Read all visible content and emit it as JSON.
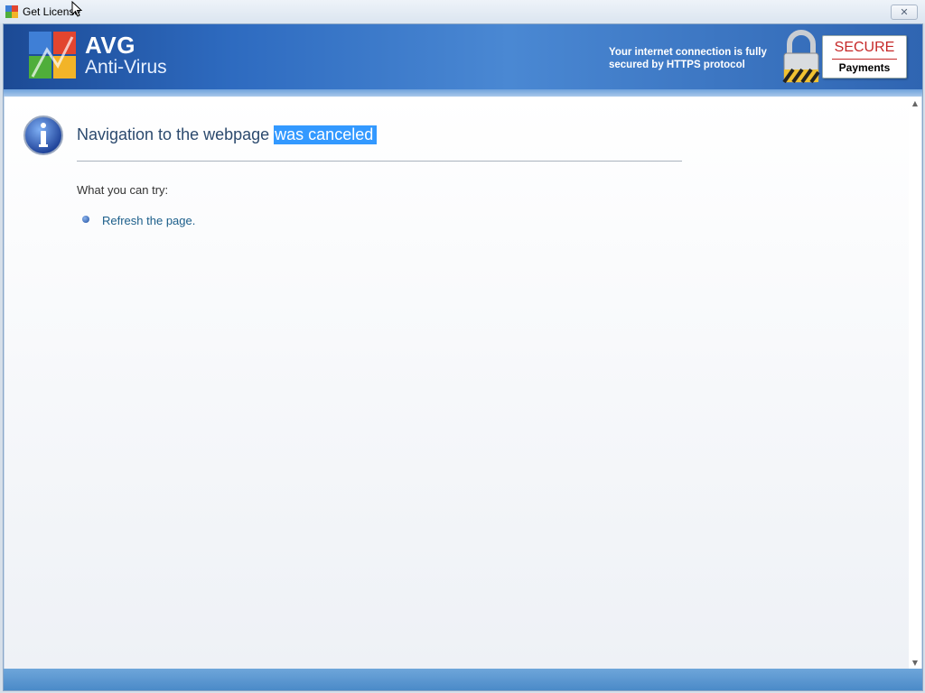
{
  "window": {
    "title": "Get License",
    "close_glyph": "✕"
  },
  "banner": {
    "brand": "AVG",
    "product": "Anti-Virus",
    "secure_message_line1": "Your internet connection is fully",
    "secure_message_line2": "secured by HTTPS protocol",
    "badge_title": "SECURE",
    "badge_subtitle": "Payments"
  },
  "content": {
    "heading_plain": "Navigation to the webpage ",
    "heading_selected": "was canceled",
    "try_label": "What you can try:",
    "suggestions": [
      {
        "label": "Refresh the page."
      }
    ]
  },
  "scrollbar": {
    "up_glyph": "▲",
    "down_glyph": "▼"
  },
  "colors": {
    "banner_blue": "#2e6bc0",
    "selection": "#3399ff",
    "secure_red": "#c62828",
    "link": "#1b5e8a"
  }
}
